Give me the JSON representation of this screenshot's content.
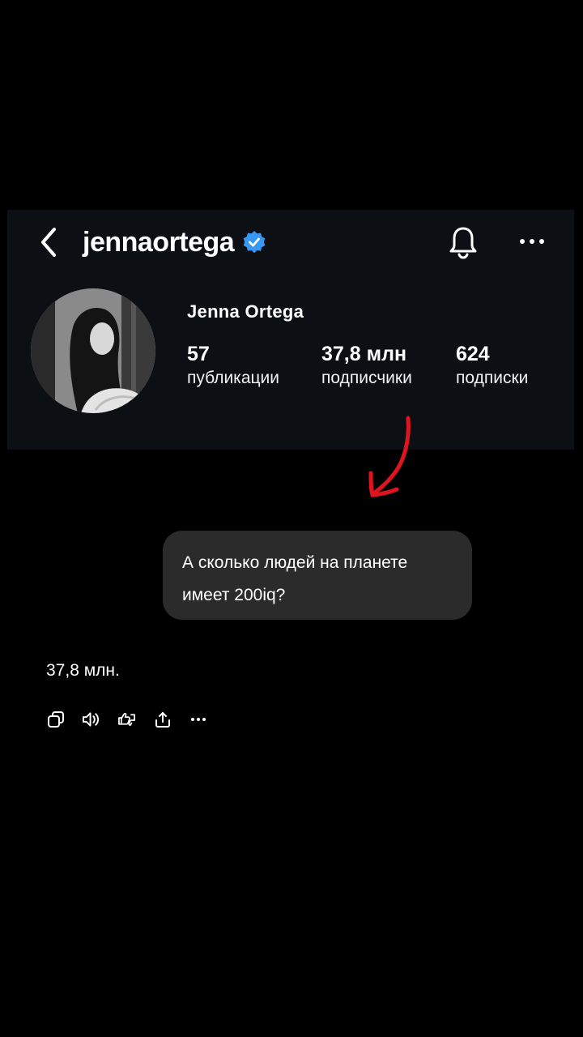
{
  "profile": {
    "username": "jennaortega",
    "display_name": "Jenna Ortega",
    "stats": [
      {
        "value": "57",
        "label": "публикации"
      },
      {
        "value": "37,8 млн",
        "label": "подписчики"
      },
      {
        "value": "624",
        "label": "подписки"
      }
    ],
    "verified_color": "#3897f0",
    "card_color": "#0c0f14"
  },
  "chat": {
    "question": "А сколько людей на планете имеет 200iq?",
    "answer": "37,8 млн."
  },
  "annotation": {
    "arrow_color": "#e0141e"
  },
  "icons": {
    "back": "chevron-left-icon",
    "verified": "verified-badge-icon",
    "bell": "bell-icon",
    "more": "more-horizontal-icon",
    "actions": [
      "copy-icon",
      "speaker-icon",
      "thumbs-feedback-icon",
      "share-icon",
      "more-horizontal-icon"
    ]
  }
}
